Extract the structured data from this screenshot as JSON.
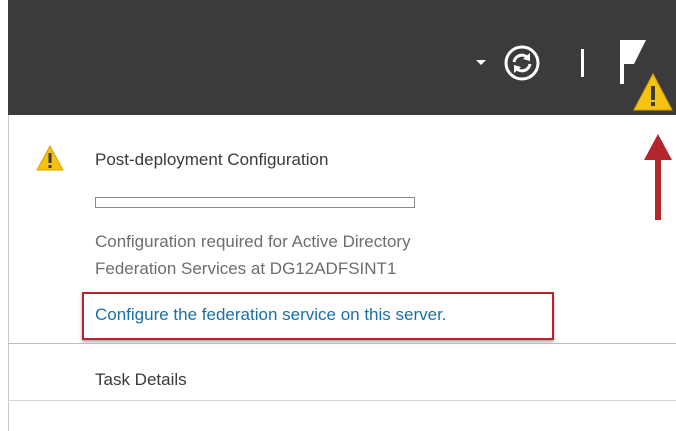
{
  "toolbar": {
    "dropdown_icon": "dropdown-arrow-icon",
    "refresh_icon": "refresh-icon",
    "notifications_icon": "notification-flag-icon",
    "warning_badge_icon": "warning-icon"
  },
  "notification": {
    "icon": "warning-icon",
    "title": "Post-deployment Configuration",
    "progress": 0,
    "description_line1": "Configuration required for Active Directory",
    "description_line2": "Federation Services at DG12ADFSINT1",
    "link_text": "Configure the federation service on this server."
  },
  "task_details_label": "Task Details",
  "colors": {
    "toolbar_bg": "#3b3b3b",
    "warning_yellow": "#f5c211",
    "link_blue": "#1a6fa8",
    "annotation_red": "#b3262c"
  }
}
